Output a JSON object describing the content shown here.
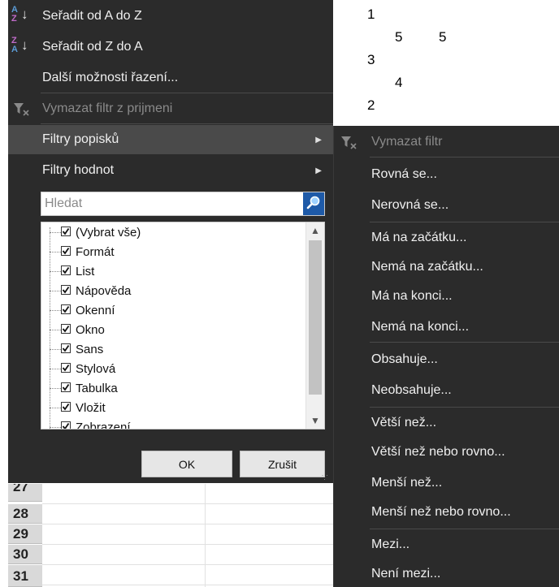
{
  "background": {
    "numbers": [
      "1",
      "5",
      "5",
      "3",
      "4",
      "2"
    ],
    "rows": [
      "27",
      "28",
      "29",
      "30",
      "31"
    ]
  },
  "menu": {
    "sort_az": "Seřadit od A do Z",
    "sort_za": "Seřadit od Z do A",
    "more_sort": "Další možnosti řazení...",
    "clear_filter": "Vymazat filtr z prijmeni",
    "label_filters": "Filtry popisků",
    "value_filters": "Filtry hodnot",
    "search_placeholder": "Hledat",
    "list_items": [
      "(Vybrat vše)",
      "Formát",
      "List",
      "Nápověda",
      "Okenní",
      "Okno",
      "Sans",
      "Stylová",
      "Tabulka",
      "Vložit",
      "Zobrazení"
    ],
    "ok": "OK",
    "cancel": "Zrušit"
  },
  "submenu": {
    "items": [
      "Vymazat filtr",
      "Rovná se...",
      "Nerovná se...",
      "Má na začátku...",
      "Nemá na začátku...",
      "Má na konci...",
      "Nemá na konci...",
      "Obsahuje...",
      "Neobsahuje...",
      "Větší než...",
      "Větší než nebo rovno...",
      "Menší než...",
      "Menší než nebo rovno...",
      "Mezi...",
      "Není mezi..."
    ]
  },
  "icons": {
    "sort_az": "sort-ascending-icon",
    "sort_za": "sort-descending-icon",
    "clear_filter": "clear-filter-icon",
    "submenu_arrow": "chevron-right-icon",
    "search": "search-icon",
    "checkbox": "check-icon",
    "scroll_up": "chevron-up-icon",
    "scroll_down": "chevron-down-icon"
  },
  "colors": {
    "menu_bg": "#2b2b2b",
    "hover_bg": "#4a4a4a",
    "search_button": "#1e5aa8",
    "disabled_text": "#8a8a8a"
  }
}
